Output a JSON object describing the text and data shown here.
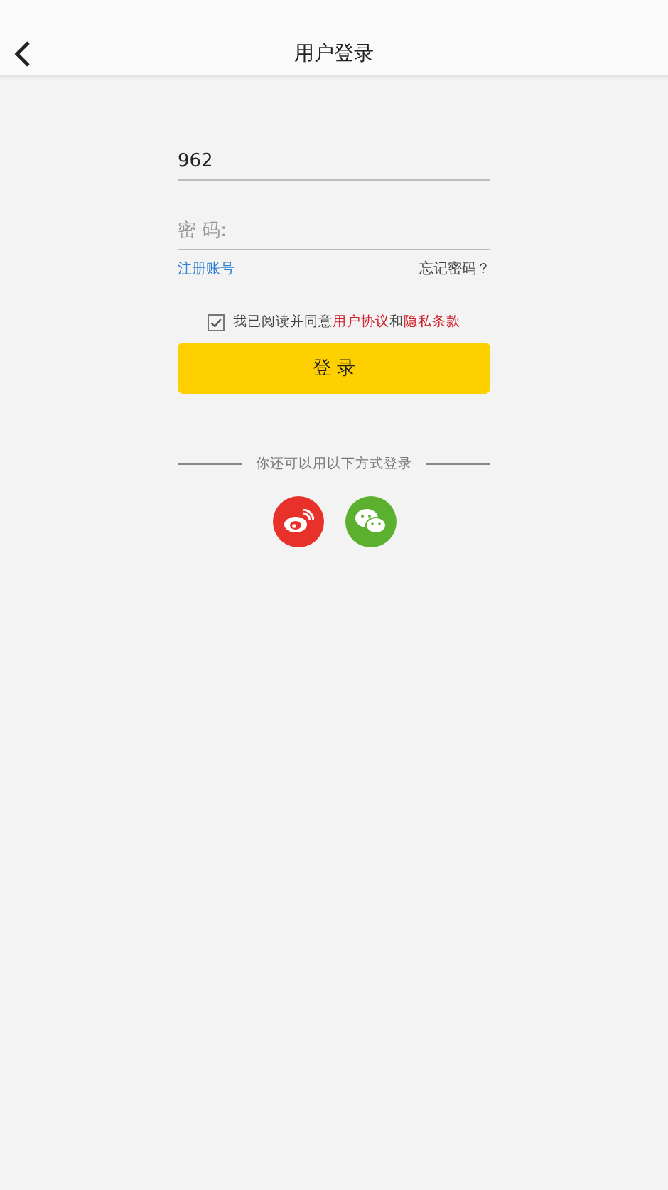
{
  "header": {
    "title": "用户登录"
  },
  "username": {
    "value": "962"
  },
  "password": {
    "placeholder": "密 码:"
  },
  "links": [
    {
      "label": "注册账号",
      "kind": "register"
    },
    {
      "label": "忘记密码？",
      "kind": "forgot"
    }
  ],
  "agreement": {
    "checked": true,
    "parts": [
      {
        "text": "我已阅读并同意",
        "kind": "plain"
      },
      {
        "text": "用户协议",
        "kind": "link"
      },
      {
        "text": "和",
        "kind": "plain"
      },
      {
        "text": "隐私条款",
        "kind": "link"
      }
    ]
  },
  "login_button": {
    "label": "登 录"
  },
  "alt_login": {
    "caption": "你还可以用以下方式登录",
    "options": [
      {
        "kind": "weibo",
        "color": "#e8312a"
      },
      {
        "kind": "wechat",
        "color": "#5bb12f"
      }
    ]
  }
}
